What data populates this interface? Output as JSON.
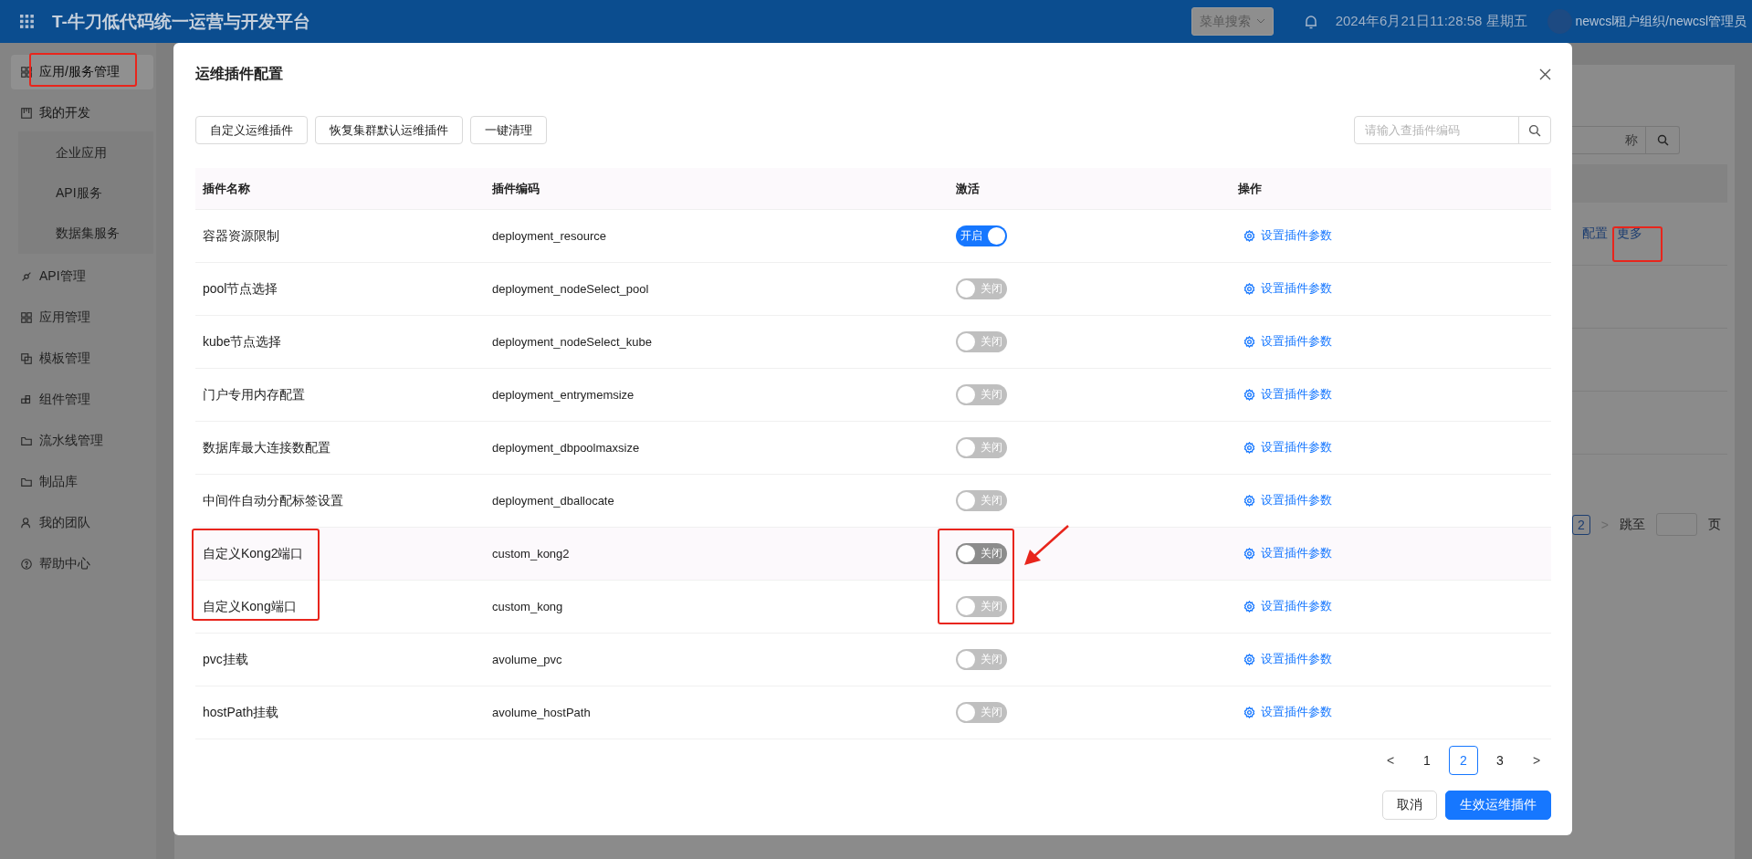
{
  "header": {
    "title": "T-牛刀低代码统一运营与开发平台",
    "menu_search": "菜单搜索",
    "datetime": "2024年6月21日11:28:58 星期五",
    "user": "newcsl租户组织/newcsl管理员"
  },
  "sidebar": {
    "items": [
      {
        "label": "应用/服务管理",
        "selected": true
      },
      {
        "label": "我的开发",
        "selected": false,
        "expanded": true,
        "children": [
          {
            "label": "企业应用",
            "selected": false
          },
          {
            "label": "API服务",
            "selected": false
          },
          {
            "label": "数据集服务",
            "selected": false
          }
        ]
      },
      {
        "label": "API管理",
        "selected": false
      },
      {
        "label": "应用管理",
        "selected": false
      },
      {
        "label": "模板管理",
        "selected": false
      },
      {
        "label": "组件管理",
        "selected": false
      },
      {
        "label": "流水线管理",
        "selected": false
      },
      {
        "label": "制品库",
        "selected": false
      },
      {
        "label": "我的团队",
        "selected": false
      },
      {
        "label": "帮助中心",
        "selected": false
      }
    ]
  },
  "background_page": {
    "search_placeholder": "称",
    "row_actions": [
      "配置",
      "更多"
    ],
    "current_page": "2",
    "next": ">",
    "jump_label": "跳至",
    "page_unit": "页"
  },
  "modal": {
    "title": "运维插件配置",
    "toolbar_buttons": [
      "自定义运维插件",
      "恢复集群默认运维插件",
      "一键清理"
    ],
    "search": {
      "placeholder": "请输入查插件编码"
    },
    "table": {
      "columns": [
        "插件名称",
        "插件编码",
        "激活",
        "操作"
      ],
      "rows": [
        {
          "name": "容器资源限制",
          "code": "deployment_resource",
          "active": true,
          "toggle_label": "开启",
          "action": "设置插件参数",
          "hovered": false
        },
        {
          "name": "pool节点选择",
          "code": "deployment_nodeSelect_pool",
          "active": false,
          "toggle_label": "关闭",
          "action": "设置插件参数",
          "hovered": false
        },
        {
          "name": "kube节点选择",
          "code": "deployment_nodeSelect_kube",
          "active": false,
          "toggle_label": "关闭",
          "action": "设置插件参数",
          "hovered": false
        },
        {
          "name": "门户专用内存配置",
          "code": "deployment_entrymemsize",
          "active": false,
          "toggle_label": "关闭",
          "action": "设置插件参数",
          "hovered": false
        },
        {
          "name": "数据库最大连接数配置",
          "code": "deployment_dbpoolmaxsize",
          "active": false,
          "toggle_label": "关闭",
          "action": "设置插件参数",
          "hovered": false
        },
        {
          "name": "中间件自动分配标签设置",
          "code": "deployment_dballocate",
          "active": false,
          "toggle_label": "关闭",
          "action": "设置插件参数",
          "hovered": false
        },
        {
          "name": "自定义Kong2端口",
          "code": "custom_kong2",
          "active": false,
          "toggle_label": "关闭",
          "action": "设置插件参数",
          "hovered": true
        },
        {
          "name": "自定义Kong端口",
          "code": "custom_kong",
          "active": false,
          "toggle_label": "关闭",
          "action": "设置插件参数",
          "hovered": false
        },
        {
          "name": "pvc挂载",
          "code": "avolume_pvc",
          "active": false,
          "toggle_label": "关闭",
          "action": "设置插件参数",
          "hovered": false
        },
        {
          "name": "hostPath挂载",
          "code": "avolume_hostPath",
          "active": false,
          "toggle_label": "关闭",
          "action": "设置插件参数",
          "hovered": false
        }
      ]
    },
    "pagination": {
      "prev": "<",
      "pages": [
        {
          "label": "1",
          "selected": false
        },
        {
          "label": "2",
          "selected": true
        },
        {
          "label": "3",
          "selected": false
        }
      ],
      "next": ">"
    },
    "buttons": [
      {
        "label": "取消",
        "kind": "default"
      },
      {
        "label": "生效运维插件",
        "kind": "primary"
      }
    ]
  }
}
